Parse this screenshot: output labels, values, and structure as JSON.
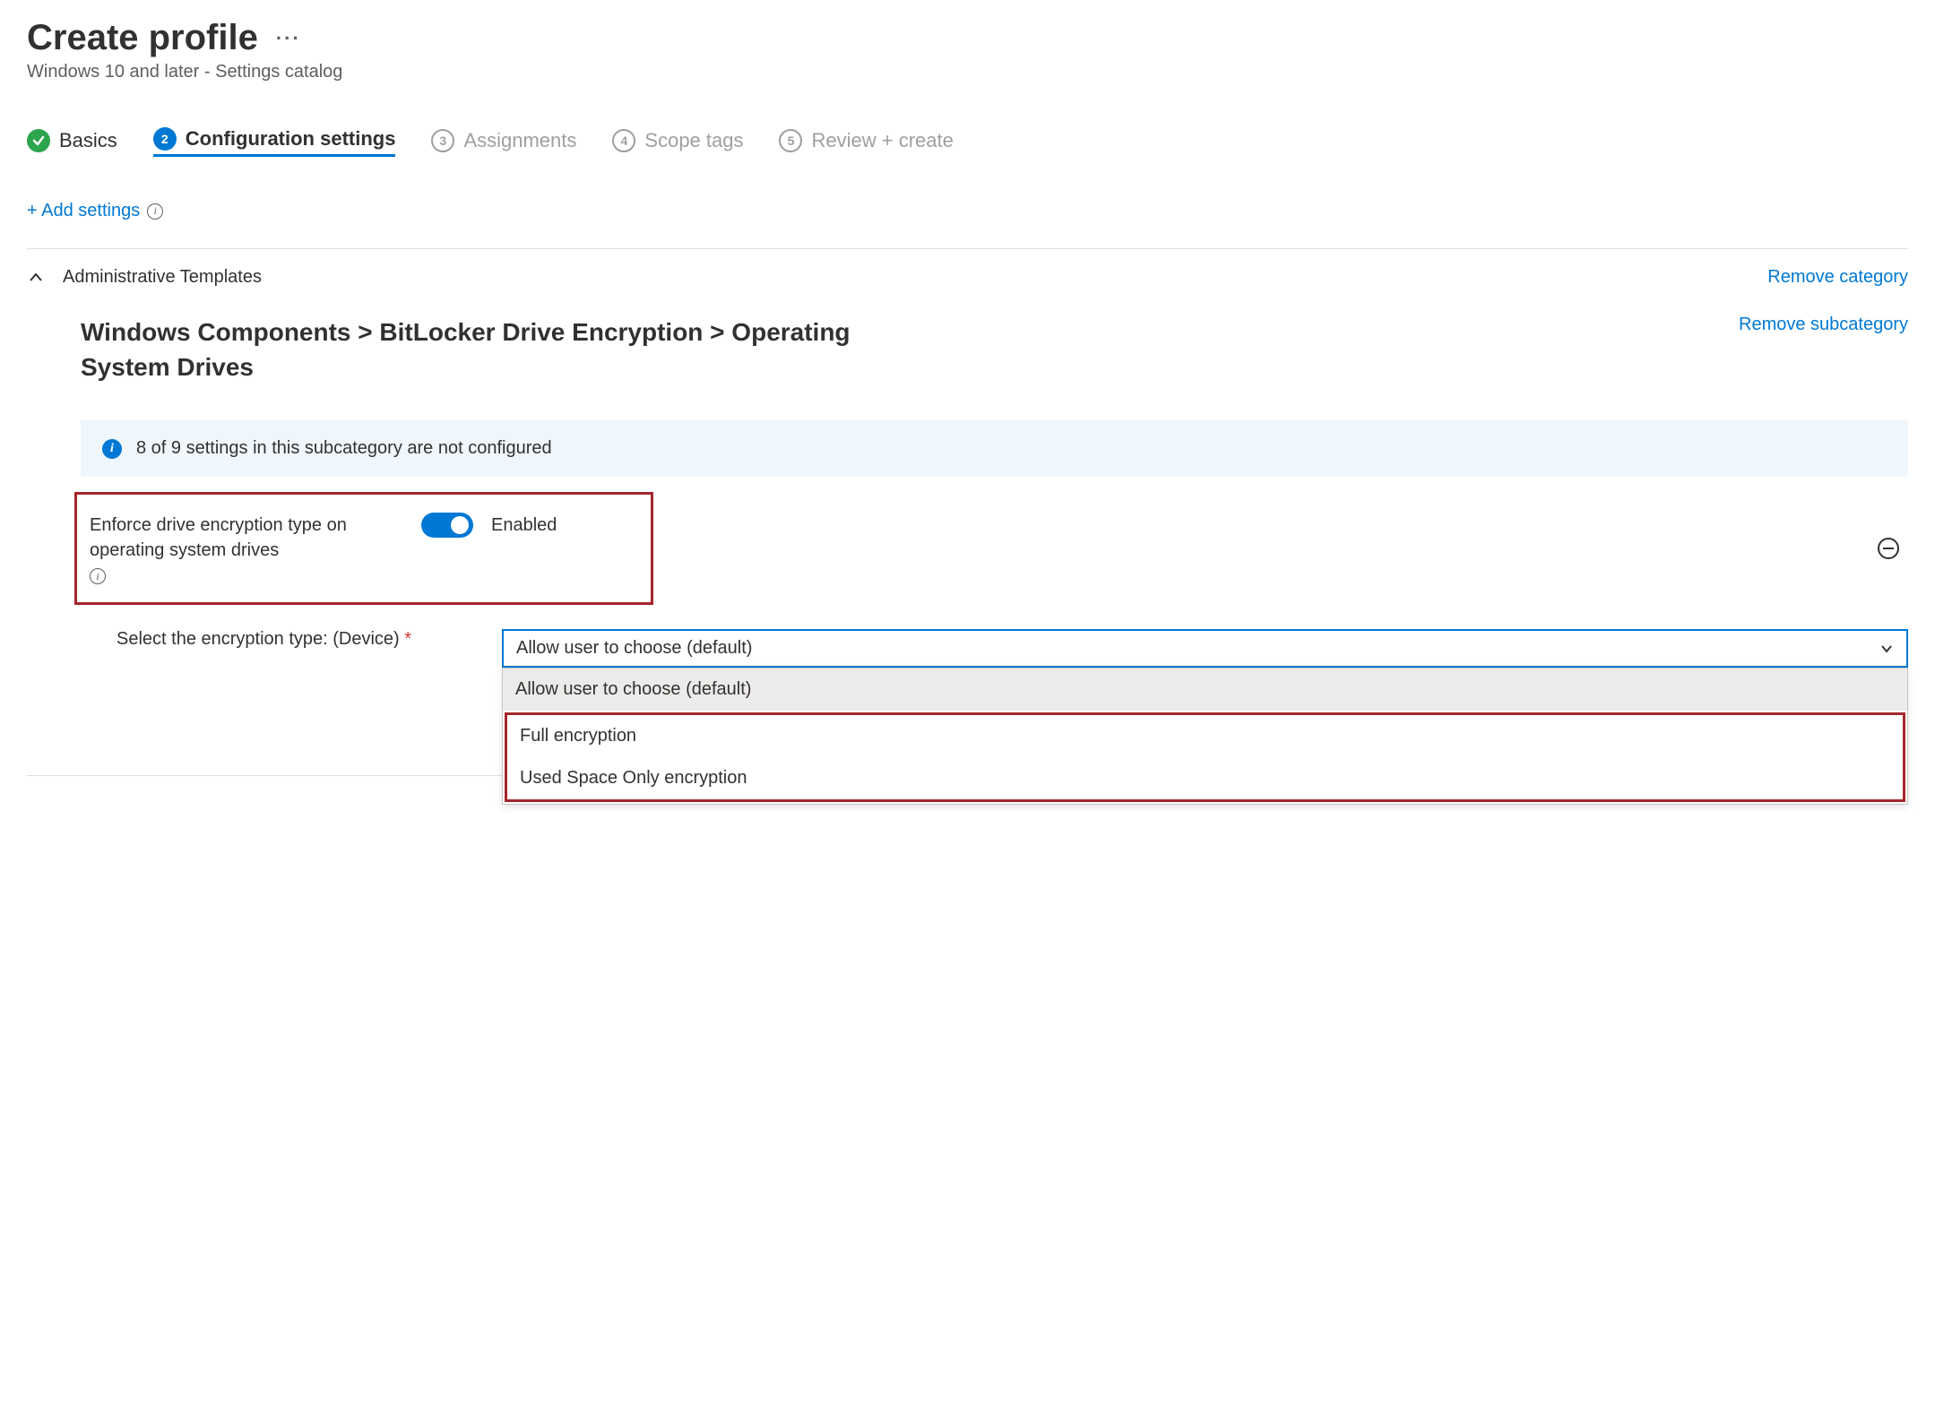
{
  "header": {
    "title": "Create profile",
    "subtitle": "Windows 10 and later - Settings catalog"
  },
  "steps": [
    {
      "label": "Basics",
      "state": "done"
    },
    {
      "label": "Configuration settings",
      "state": "current",
      "num": "2"
    },
    {
      "label": "Assignments",
      "state": "pending",
      "num": "3"
    },
    {
      "label": "Scope tags",
      "state": "pending",
      "num": "4"
    },
    {
      "label": "Review + create",
      "state": "pending",
      "num": "5"
    }
  ],
  "actions": {
    "add_settings": "+ Add settings"
  },
  "category": {
    "name": "Administrative Templates",
    "remove_label": "Remove category"
  },
  "subcategory": {
    "breadcrumb": "Windows Components > BitLocker Drive Encryption > Operating System Drives",
    "remove_label": "Remove subcategory"
  },
  "banner": {
    "text": "8 of 9 settings in this subcategory are not configured"
  },
  "setting": {
    "label": "Enforce drive encryption type on operating system drives",
    "toggle_state": "Enabled"
  },
  "encryption_select": {
    "label": "Select the encryption type: (Device)",
    "required_marker": "*",
    "selected": "Allow user to choose (default)",
    "options": [
      "Allow user to choose (default)",
      "Full encryption",
      "Used Space Only encryption"
    ]
  }
}
